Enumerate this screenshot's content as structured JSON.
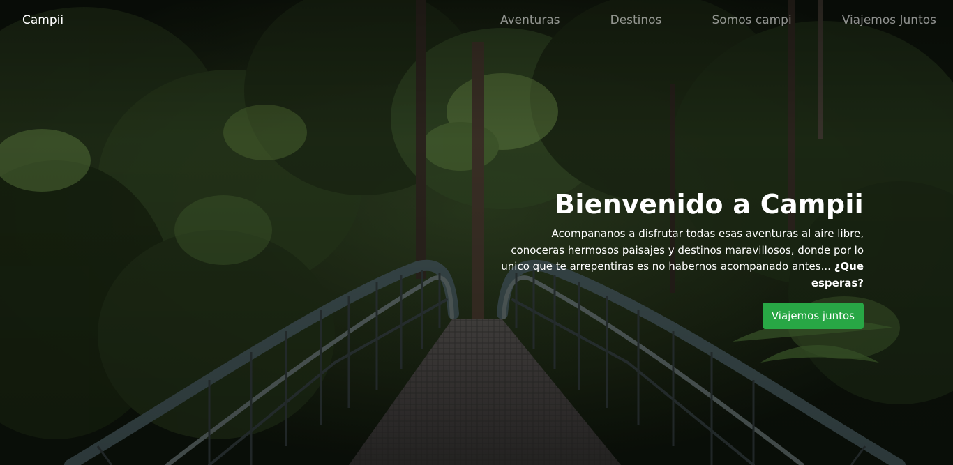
{
  "navbar": {
    "brand": "Campii",
    "links": [
      "Aventuras",
      "Destinos",
      "Somos campi",
      "Viajemos Juntos"
    ]
  },
  "hero": {
    "title": "Bienvenido a Campii",
    "text": "Acompananos a disfrutar todas esas aventuras al aire libre, conoceras hermosos paisajes y destinos maravillosos, donde por lo unico que te arrepentiras es no habernos acompanado antes...",
    "text_emphasis": "¿Que esperas?",
    "cta_label": "Viajemos juntos",
    "background": "forest footbridge photo"
  },
  "colors": {
    "cta": "#28a745",
    "nav_text_muted": "rgba(255,255,255,0.55)",
    "foreground": "#ffffff"
  }
}
